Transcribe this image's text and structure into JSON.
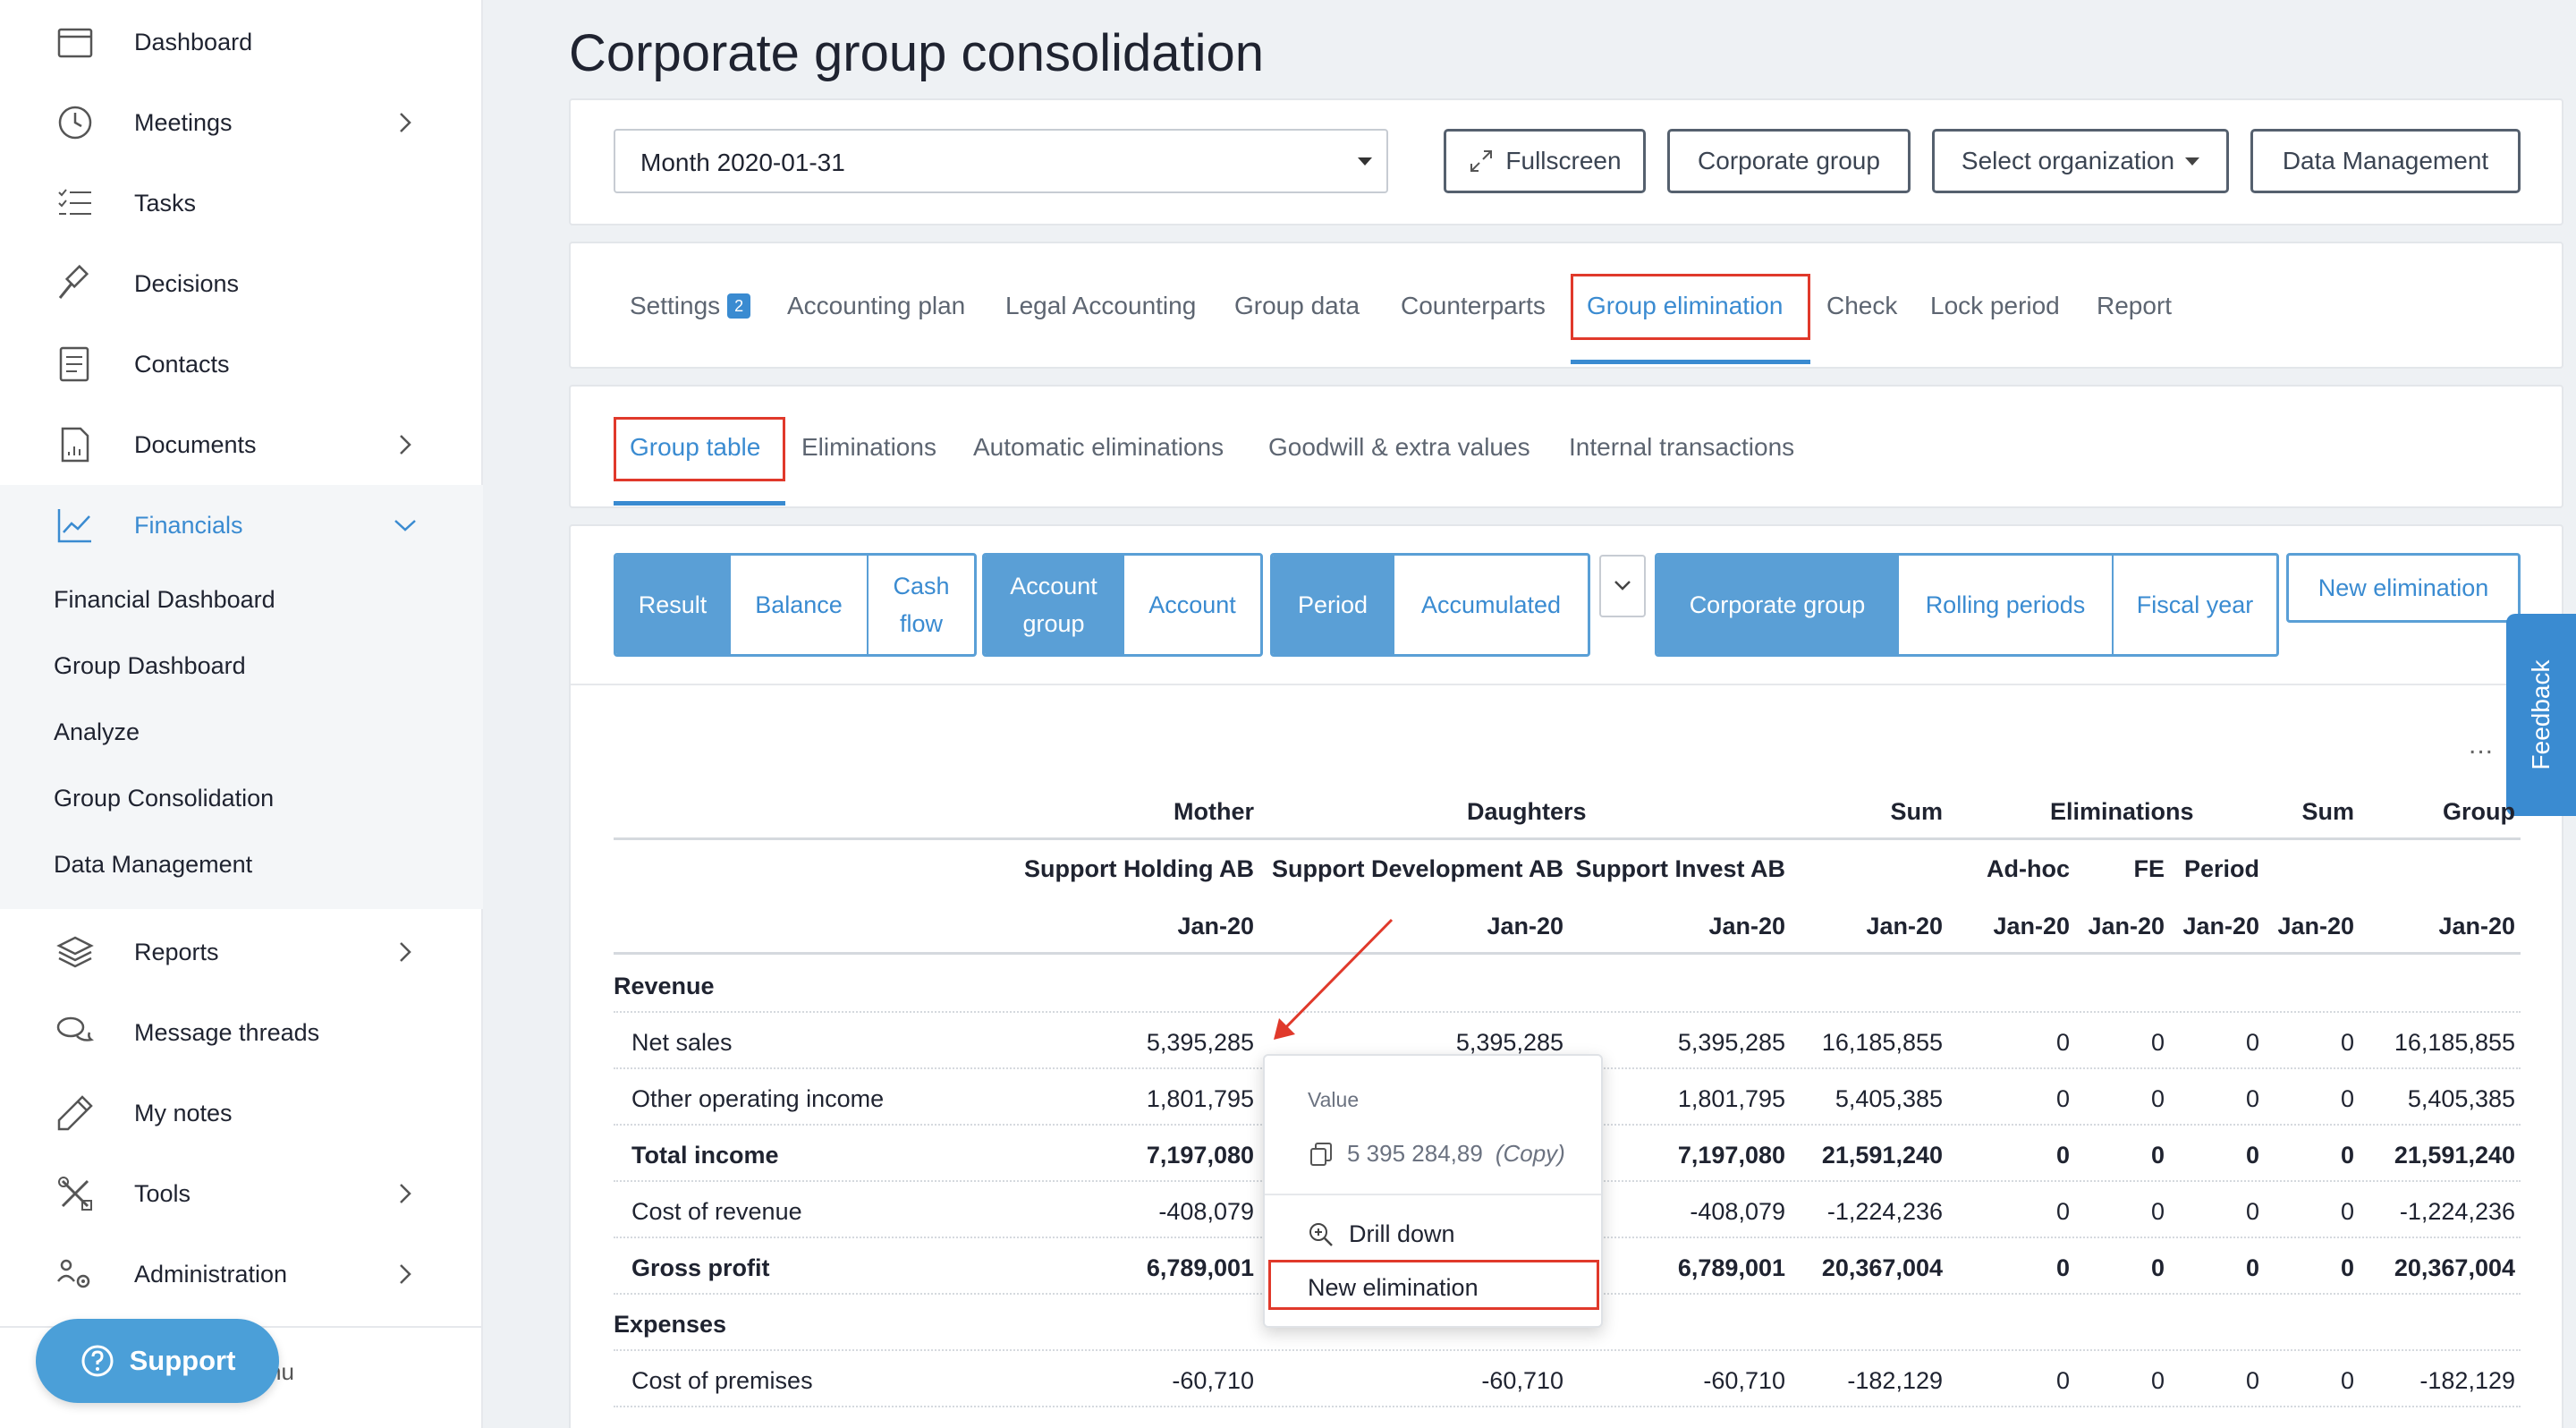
{
  "sidebar": {
    "items": [
      {
        "label": "Dashboard"
      },
      {
        "label": "Meetings"
      },
      {
        "label": "Tasks"
      },
      {
        "label": "Decisions"
      },
      {
        "label": "Contacts"
      },
      {
        "label": "Documents"
      },
      {
        "label": "Financials"
      },
      {
        "label": "Reports"
      },
      {
        "label": "Message threads"
      },
      {
        "label": "My notes"
      },
      {
        "label": "Tools"
      },
      {
        "label": "Administration"
      }
    ],
    "financials_sub": [
      "Financial Dashboard",
      "Group Dashboard",
      "Analyze",
      "Group Consolidation",
      "Data Management"
    ],
    "support_label": "Support",
    "menu_text": "nu"
  },
  "page": {
    "title": "Corporate group consolidation"
  },
  "toolbar": {
    "month_value": "Month 2020-01-31",
    "fullscreen": "Fullscreen",
    "corporate_group": "Corporate group",
    "select_org": "Select organization",
    "data_management": "Data Management"
  },
  "main_tabs": {
    "settings": "Settings",
    "settings_badge": "2",
    "accounting_plan": "Accounting plan",
    "legal_accounting": "Legal Accounting",
    "group_data": "Group data",
    "counterparts": "Counterparts",
    "group_elimination": "Group elimination",
    "check": "Check",
    "lock_period": "Lock period",
    "report": "Report"
  },
  "sub_tabs": {
    "group_table": "Group table",
    "eliminations": "Eliminations",
    "automatic_eliminations": "Automatic eliminations",
    "goodwill": "Goodwill & extra values",
    "internal_transactions": "Internal transactions"
  },
  "segments": {
    "result": "Result",
    "balance": "Balance",
    "cash_flow": "Cash flow",
    "account_group": "Account group",
    "account": "Account",
    "period": "Period",
    "accumulated": "Accumulated",
    "corporate_group": "Corporate group",
    "rolling_periods": "Rolling periods",
    "fiscal_year": "Fiscal year",
    "new_elimination": "New elimination"
  },
  "feedback": "Feedback",
  "more": "...",
  "table": {
    "head1": {
      "mother": "Mother",
      "daughters": "Daughters",
      "sum1": "Sum",
      "eliminations": "Eliminations",
      "sum2": "Sum",
      "group": "Group"
    },
    "head2": {
      "c1": "Support Holding AB",
      "c2": "Support Development AB",
      "c3": "Support Invest AB",
      "adhoc": "Ad-hoc",
      "fe": "FE",
      "period": "Period"
    },
    "period_label": "Jan-20",
    "sections": {
      "revenue": "Revenue",
      "expenses": "Expenses"
    },
    "rows": [
      {
        "label": "Net sales",
        "bold": false,
        "vals": [
          "5,395,285",
          "5,395,285",
          "5,395,285",
          "16,185,855",
          "0",
          "0",
          "0",
          "0",
          "16,185,855"
        ]
      },
      {
        "label": "Other operating income",
        "bold": false,
        "vals": [
          "1,801,795",
          "",
          "1,801,795",
          "5,405,385",
          "0",
          "0",
          "0",
          "0",
          "5,405,385"
        ]
      },
      {
        "label": "Total income",
        "bold": true,
        "vals": [
          "7,197,080",
          "",
          "7,197,080",
          "21,591,240",
          "0",
          "0",
          "0",
          "0",
          "21,591,240"
        ]
      },
      {
        "label": "Cost of revenue",
        "bold": false,
        "vals": [
          "-408,079",
          "",
          "-408,079",
          "-1,224,236",
          "0",
          "0",
          "0",
          "0",
          "-1,224,236"
        ]
      },
      {
        "label": "Gross profit",
        "bold": true,
        "vals": [
          "6,789,001",
          "",
          "6,789,001",
          "20,367,004",
          "0",
          "0",
          "0",
          "0",
          "20,367,004"
        ]
      },
      {
        "label": "Cost of premises",
        "bold": false,
        "vals": [
          "-60,710",
          "-60,710",
          "-60,710",
          "-182,129",
          "0",
          "0",
          "0",
          "0",
          "-182,129"
        ]
      }
    ]
  },
  "popup": {
    "title": "Value",
    "copy_value": "5 395 284,89",
    "copy_label": "(Copy)",
    "drill_down": "Drill down",
    "new_elimination": "New elimination"
  },
  "colors": {
    "accent": "#3a8bd1",
    "highlight": "#e0392b"
  }
}
